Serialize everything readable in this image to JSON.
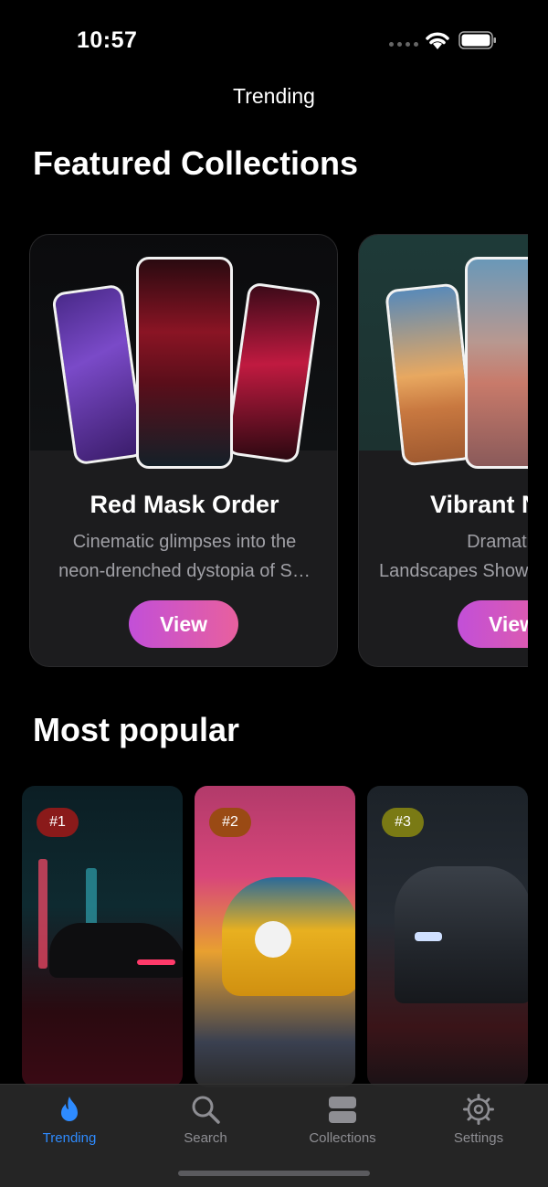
{
  "status_bar": {
    "time": "10:57"
  },
  "nav": {
    "title": "Trending"
  },
  "featured": {
    "section_title": "Featured Collections",
    "collections": [
      {
        "name": "Red Mask Order",
        "description_line1": "Cinematic glimpses into the",
        "description_line2": "neon-drenched dystopia of S…",
        "button_label": "View"
      },
      {
        "name": "Vibrant N",
        "description_line1": "Dramatic an",
        "description_line2": "Landscapes Show",
        "button_label": "View"
      }
    ]
  },
  "popular": {
    "section_title": "Most popular",
    "items": [
      {
        "rank": "#1",
        "badge_color": "#8a1a1a"
      },
      {
        "rank": "#2",
        "badge_color": "#9a4a14"
      },
      {
        "rank": "#3",
        "badge_color": "#7a7a14"
      }
    ]
  },
  "tab_bar": {
    "tabs": [
      {
        "label": "Trending",
        "icon": "flame-icon",
        "active": true
      },
      {
        "label": "Search",
        "icon": "search-icon",
        "active": false
      },
      {
        "label": "Collections",
        "icon": "stack-icon",
        "active": false
      },
      {
        "label": "Settings",
        "icon": "gear-icon",
        "active": false
      }
    ],
    "active_color": "#2e8bff"
  },
  "colors": {
    "accent_gradient_start": "#c24fd8",
    "accent_gradient_end": "#e8609e"
  }
}
